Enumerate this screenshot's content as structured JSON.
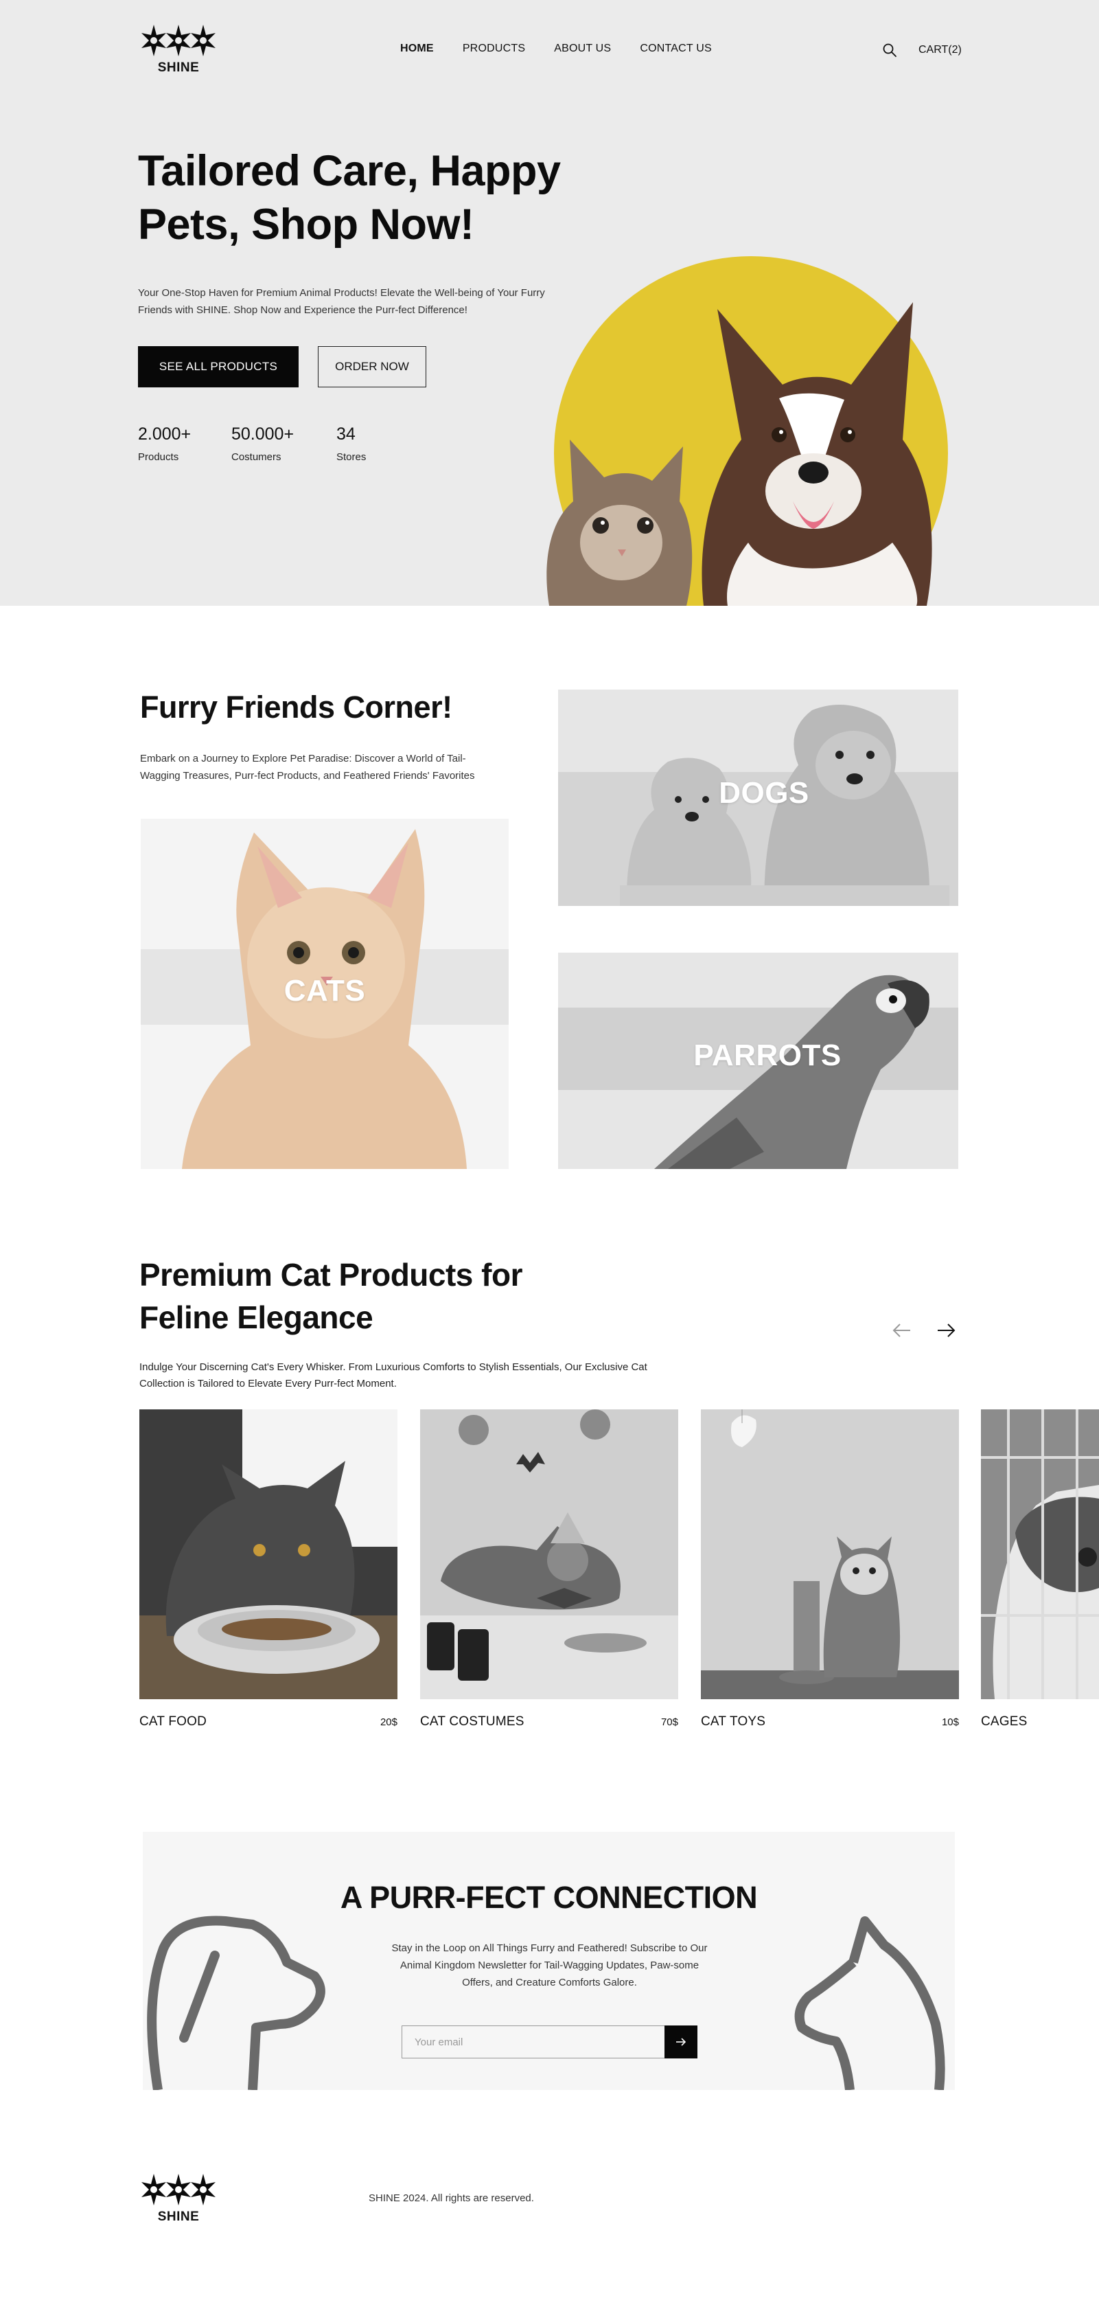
{
  "brand": {
    "name": "SHINE"
  },
  "nav": {
    "items": [
      "HOME",
      "PRODUCTS",
      "ABOUT US",
      "CONTACT US"
    ],
    "active": "HOME"
  },
  "header": {
    "cart_label": "CART(2)",
    "search_icon": "search-icon"
  },
  "hero": {
    "title": "Tailored Care, Happy Pets, Shop Now!",
    "description": "Your One-Stop Haven for Premium Animal Products! Elevate the Well-being of Your Furry Friends with SHINE. Shop Now and Experience the Purr-fect Difference!",
    "primary_button": "SEE ALL PRODUCTS",
    "secondary_button": "ORDER NOW",
    "stats": [
      {
        "value": "2.000+",
        "label": "Products"
      },
      {
        "value": "50.000+",
        "label": "Costumers"
      },
      {
        "value": "34",
        "label": "Stores"
      }
    ],
    "accent_color": "#e3c730"
  },
  "furry_friends": {
    "title": "Furry Friends Corner!",
    "description": "Embark on a Journey to Explore Pet Paradise: Discover a World of Tail-Wagging Treasures, Purr-fect Products, and Feathered Friends' Favorites",
    "tiles": [
      {
        "label": "CATS"
      },
      {
        "label": "DOGS"
      },
      {
        "label": "PARROTS"
      }
    ]
  },
  "cat_products": {
    "title": "Premium Cat Products for Feline Elegance",
    "description": "Indulge Your Discerning Cat's Every Whisker. From Luxurious Comforts to Stylish Essentials, Our Exclusive Cat Collection is Tailored to Elevate Every Purr-fect Moment.",
    "prev_icon": "arrow-left-icon",
    "next_icon": "arrow-right-icon",
    "items": [
      {
        "name": "CAT FOOD",
        "price": "20$"
      },
      {
        "name": "CAT COSTUMES",
        "price": "70$"
      },
      {
        "name": "CAT TOYS",
        "price": "10$"
      },
      {
        "name": "CAGES",
        "price": ""
      }
    ]
  },
  "newsletter": {
    "title": "A PURR-FECT CONNECTION",
    "description": "Stay in the Loop on All Things Furry and Feathered! Subscribe to Our Animal Kingdom Newsletter for Tail-Wagging Updates, Paw-some Offers, and Creature Comforts Galore.",
    "email_placeholder": "Your email",
    "submit_icon": "arrow-right-icon"
  },
  "footer": {
    "copyright": "SHINE 2024. All rights are reserved."
  }
}
